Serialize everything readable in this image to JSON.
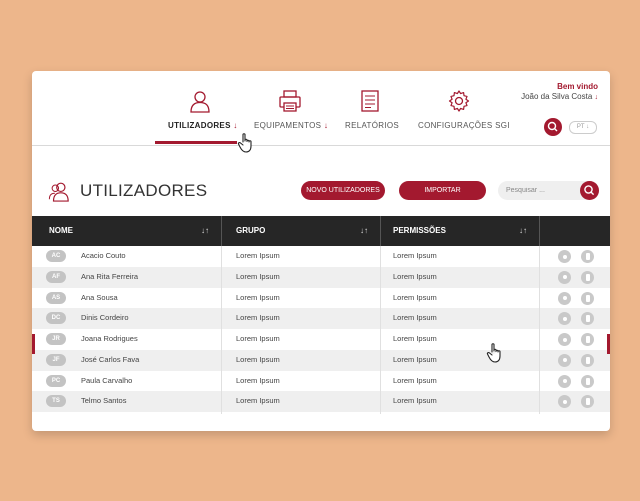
{
  "header": {
    "nav": [
      {
        "label": "UTILIZADORES",
        "arrow": "↓",
        "icon": "user-icon",
        "active": true
      },
      {
        "label": "EQUIPAMENTOS",
        "arrow": "↓",
        "icon": "printer-icon"
      },
      {
        "label": "RELATÓRIOS",
        "arrow": "",
        "icon": "document-icon"
      },
      {
        "label": "CONFIGURAÇÕES SGI",
        "arrow": "",
        "icon": "gear-icon"
      }
    ],
    "welcome": "Bem vindo",
    "user_name": "João da Silva Costa",
    "user_arrow": "↓",
    "lang": "PT ↓"
  },
  "page": {
    "title": "UTILIZADORES",
    "new_button": "NOVO UTILIZADORES",
    "import_button": "IMPORTAR",
    "search_placeholder": "Pesquisar ..."
  },
  "table": {
    "columns": [
      "NOME",
      "GRUPO",
      "PERMISSÕES"
    ],
    "sort_icon": "↓↑",
    "rows": [
      {
        "initials": "AC",
        "name": "Acacio Couto",
        "group": "Lorem Ipsum",
        "permissions": "Lorem Ipsum"
      },
      {
        "initials": "AF",
        "name": "Ana Rita Ferreira",
        "group": "Lorem Ipsum",
        "permissions": "Lorem Ipsum"
      },
      {
        "initials": "AS",
        "name": "Ana Sousa",
        "group": "Lorem Ipsum",
        "permissions": "Lorem Ipsum"
      },
      {
        "initials": "DC",
        "name": "Dinis Cordeiro",
        "group": "Lorem Ipsum",
        "permissions": "Lorem Ipsum"
      },
      {
        "initials": "JR",
        "name": "Joana Rodrigues",
        "group": "Lorem Ipsum",
        "permissions": "Lorem Ipsum"
      },
      {
        "initials": "JF",
        "name": "José Carlos Fava",
        "group": "Lorem Ipsum",
        "permissions": "Lorem Ipsum"
      },
      {
        "initials": "PC",
        "name": "Paula Carvalho",
        "group": "Lorem Ipsum",
        "permissions": "Lorem Ipsum"
      },
      {
        "initials": "TS",
        "name": "Telmo Santos",
        "group": "Lorem Ipsum",
        "permissions": "Lorem Ipsum"
      }
    ]
  },
  "colors": {
    "accent": "#A3192F",
    "background": "#EDB68B",
    "table_header": "#262626"
  }
}
